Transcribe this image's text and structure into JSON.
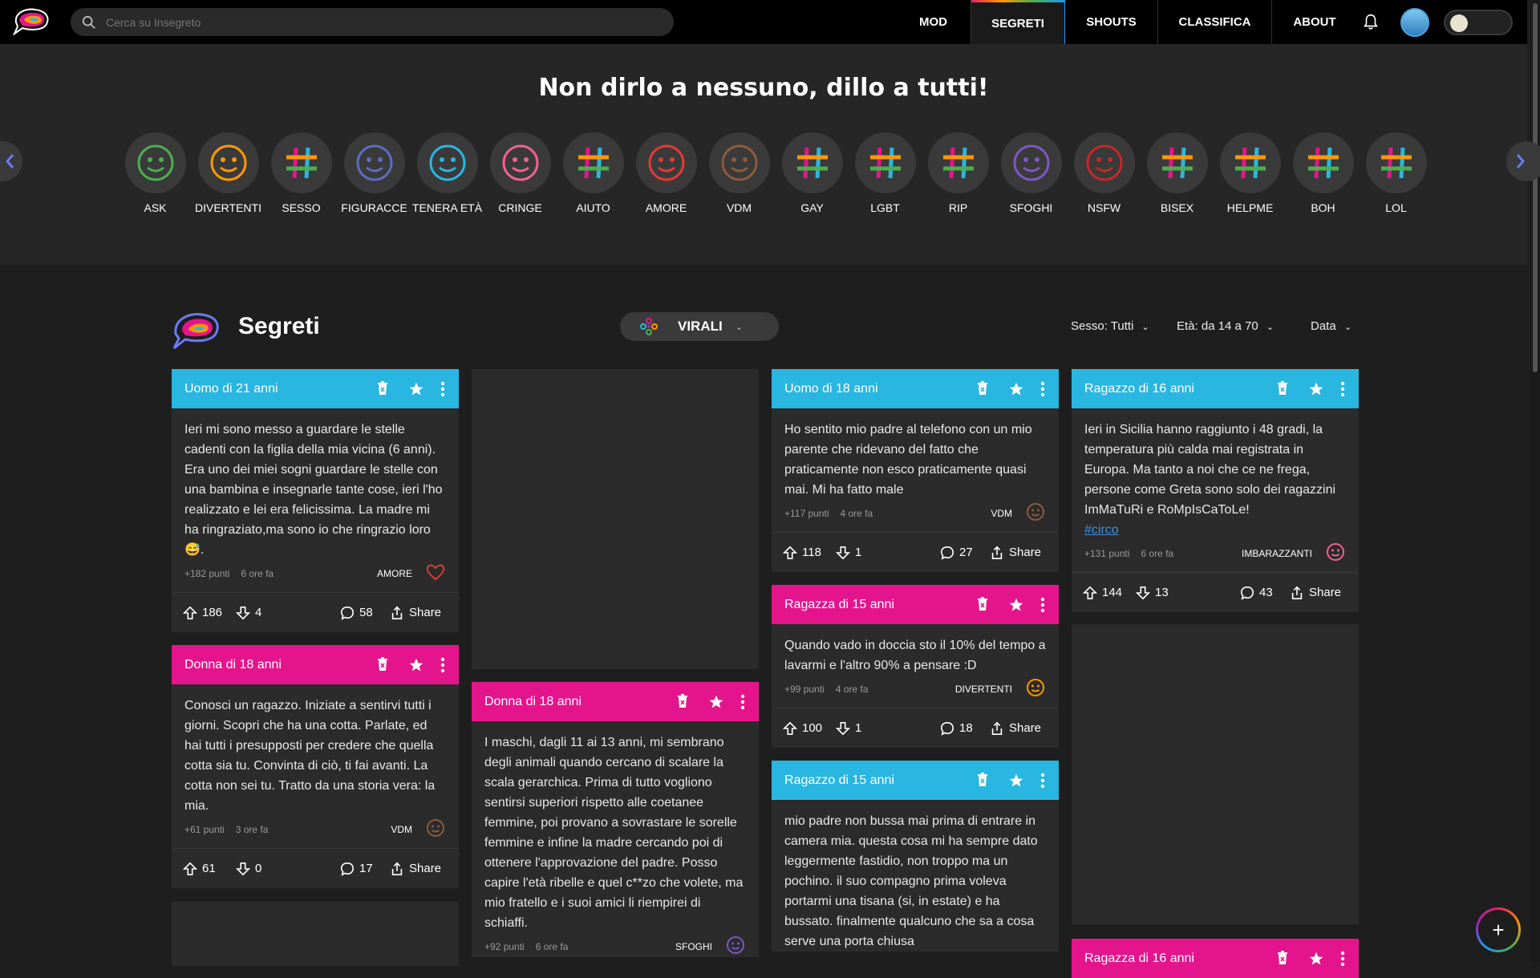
{
  "search": {
    "placeholder": "Cerca su Insegreto"
  },
  "nav": [
    "MOD",
    "SEGRETI",
    "SHOUTS",
    "CLASSIFICA",
    "ABOUT"
  ],
  "hero_title": "Non dirlo a nessuno, dillo a tutti!",
  "categories": [
    "ASK",
    "DIVERTENTI",
    "SESSO",
    "FIGURACCE",
    "TENERA ETÀ",
    "CRINGE",
    "AIUTO",
    "AMORE",
    "VDM",
    "GAY",
    "LGBT",
    "RIP",
    "SFOGHI",
    "NSFW",
    "BISEX",
    "HELPME",
    "BOH",
    "LOL"
  ],
  "section": {
    "title": "Segreti",
    "sort": "VIRALI"
  },
  "filters": {
    "sesso": "Sesso: Tutti",
    "eta": "Età: da 14 a 70",
    "data": "Data"
  },
  "share_label": "Share",
  "posts": [
    {
      "author": "Uomo di 21 anni",
      "color": "#29b6e0",
      "text": "Ieri mi sono messo a guardare le stelle cadenti con la figlia della mia vicina (6 anni). Era uno dei miei sogni guardare le stelle con una bambina e insegnarle tante cose, ieri l'ho realizzato e lei era felicissima. La madre mi ha ringraziato,ma sono io che ringrazio loro😅.",
      "points": "+182 punti",
      "time": "6 ore fa",
      "category": "AMORE",
      "up": "186",
      "down": "4",
      "comments": "58"
    },
    {
      "author": "Donna di 18 anni",
      "color": "#e4158c",
      "text": "Conosci un ragazzo. Iniziate a sentirvi tutti i giorni. Scopri che ha una cotta. Parlate, ed hai tutti i presupposti per credere che quella cotta sia tu. Convinta di ciò, ti fai avanti. La cotta non sei tu. Tratto da una storia vera: la mia.",
      "points": "+61 punti",
      "time": "3 ore fa",
      "category": "VDM",
      "up": "61",
      "down": "0",
      "comments": "17"
    },
    {
      "author": "Donna di 18 anni",
      "color": "#e4158c",
      "text": "I maschi, dagli 11 ai 13 anni, mi sembrano degli animali quando cercano di scalare la scala gerarchica. Prima di tutto vogliono sentirsi superiori rispetto alle coetanee femmine, poi provano a sovrastare le sorelle femmine e infine la madre cercando poi di ottenere l'approvazione del padre. Posso capire l'età ribelle e quel c**zo che volete, ma mio fratello e i suoi amici li riempirei di schiaffi.",
      "points": "+92 punti",
      "time": "6 ore fa",
      "category": "SFOGHI"
    },
    {
      "author": "Uomo di 18 anni",
      "color": "#29b6e0",
      "text": "Ho sentito mio padre al telefono con un mio parente che ridevano del fatto che praticamente non esco praticamente quasi mai. Mi ha fatto male",
      "points": "+117 punti",
      "time": "4 ore fa",
      "category": "VDM",
      "up": "118",
      "down": "1",
      "comments": "27"
    },
    {
      "author": "Ragazza di 15 anni",
      "color": "#e4158c",
      "text": "Quando vado in doccia sto il 10% del tempo a lavarmi e l'altro 90% a pensare :D",
      "points": "+99 punti",
      "time": "4 ore fa",
      "category": "DIVERTENTI",
      "up": "100",
      "down": "1",
      "comments": "18"
    },
    {
      "author": "Ragazzo di 15 anni",
      "color": "#29b6e0",
      "text": "mio padre non bussa mai prima di entrare in camera mia. questa cosa mi ha sempre dato leggermente fastidio, non troppo ma un pochino. il suo compagno prima voleva portarmi una tisana (si, in estate) e ha bussato. finalmente qualcuno che sa a cosa serve una porta chiusa"
    },
    {
      "author": "Ragazzo di 16 anni",
      "color": "#29b6e0",
      "text": "Ieri in Sicilia hanno raggiunto i 48 gradi, la temperatura più calda mai registrata in Europa. Ma tanto a noi che ce ne frega, persone come Greta sono solo dei ragazzini ImMaTuRi e RoMpIsCaToLe!",
      "hashtag": "#circo",
      "points": "+131 punti",
      "time": "6 ore fa",
      "category": "IMBARAZZANTI",
      "up": "144",
      "down": "13",
      "comments": "43"
    },
    {
      "author": "Ragazza di 16 anni",
      "color": "#e4158c"
    }
  ]
}
